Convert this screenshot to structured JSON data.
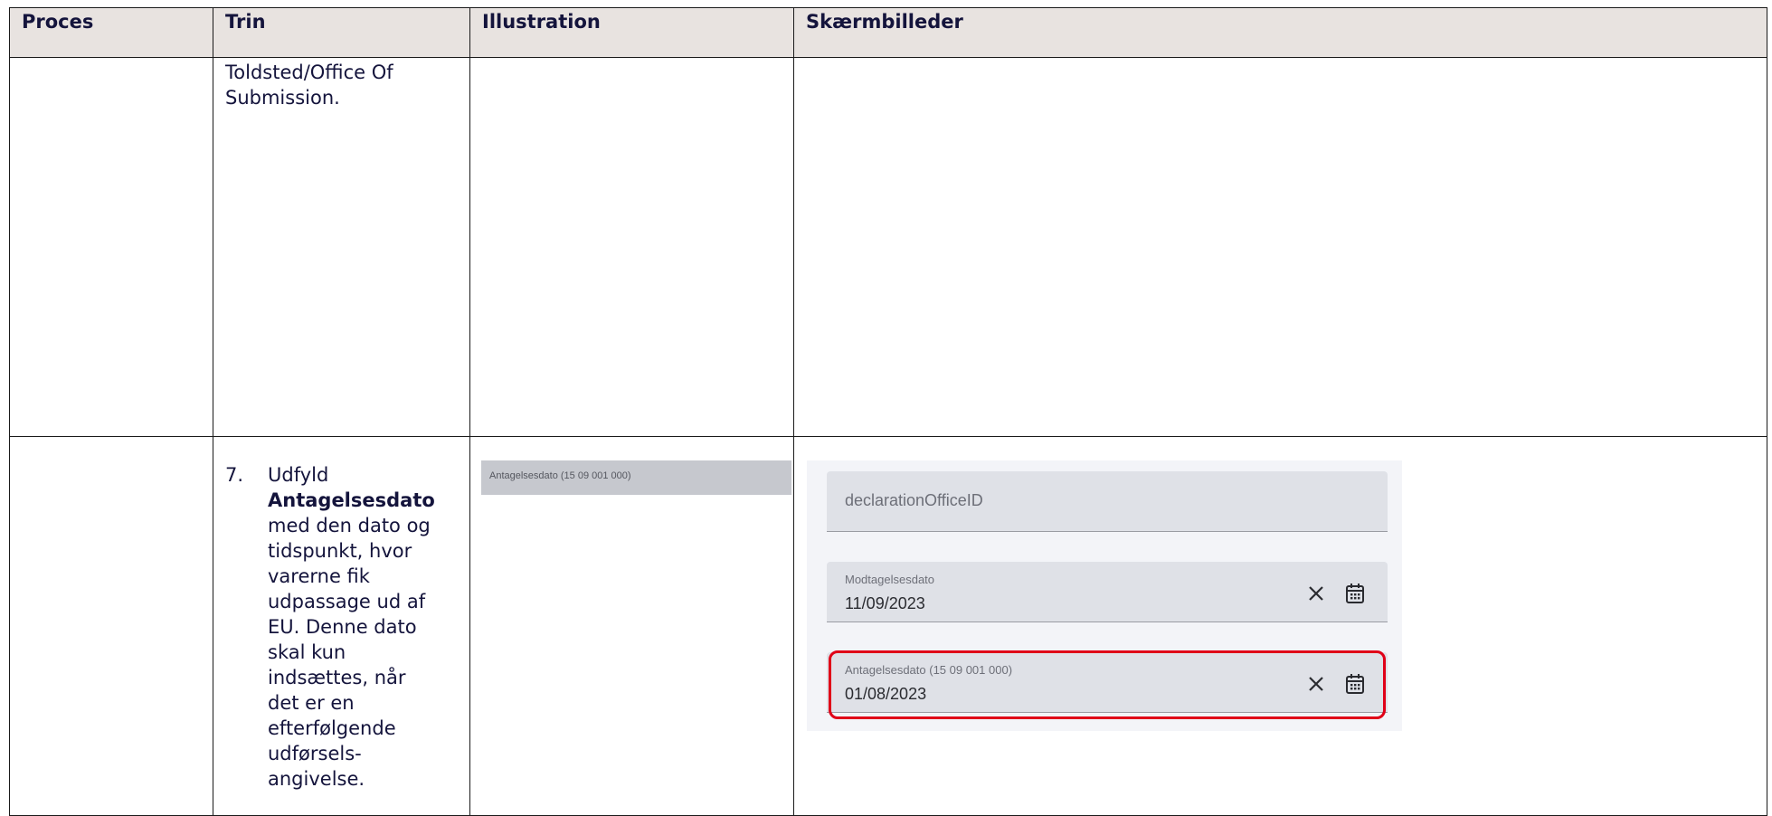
{
  "table": {
    "headers": [
      "Proces",
      "Trin",
      "Illustration",
      "Skærmbilleder"
    ],
    "rows": [
      {
        "proces": "",
        "trin_text": "Toldsted/Office Of Submission."
      },
      {
        "proces": "",
        "step_number": "7.",
        "step_prefix": "Udfyld",
        "step_bold": "Antagelsesdato",
        "step_suffix": "med den dato og tidspunkt, hvor varerne fik udpassage ud af EU. Denne dato skal kun indsættes, når det er en efterfølgende udførsels-angivelse.",
        "illustration_label": "Antagelsesdato (15 09 001 000)",
        "screenshot": {
          "field1_placeholder": "declarationOfficeID",
          "field2_label": "Modtagelsesdato",
          "field2_value": "11/09/2023",
          "field3_label": "Antagelsesdato (15 09 001 000)",
          "field3_value": "01/08/2023",
          "clear_icon": "close-icon",
          "calendar_icon": "calendar-icon",
          "highlight_color": "#e00018"
        }
      }
    ]
  }
}
